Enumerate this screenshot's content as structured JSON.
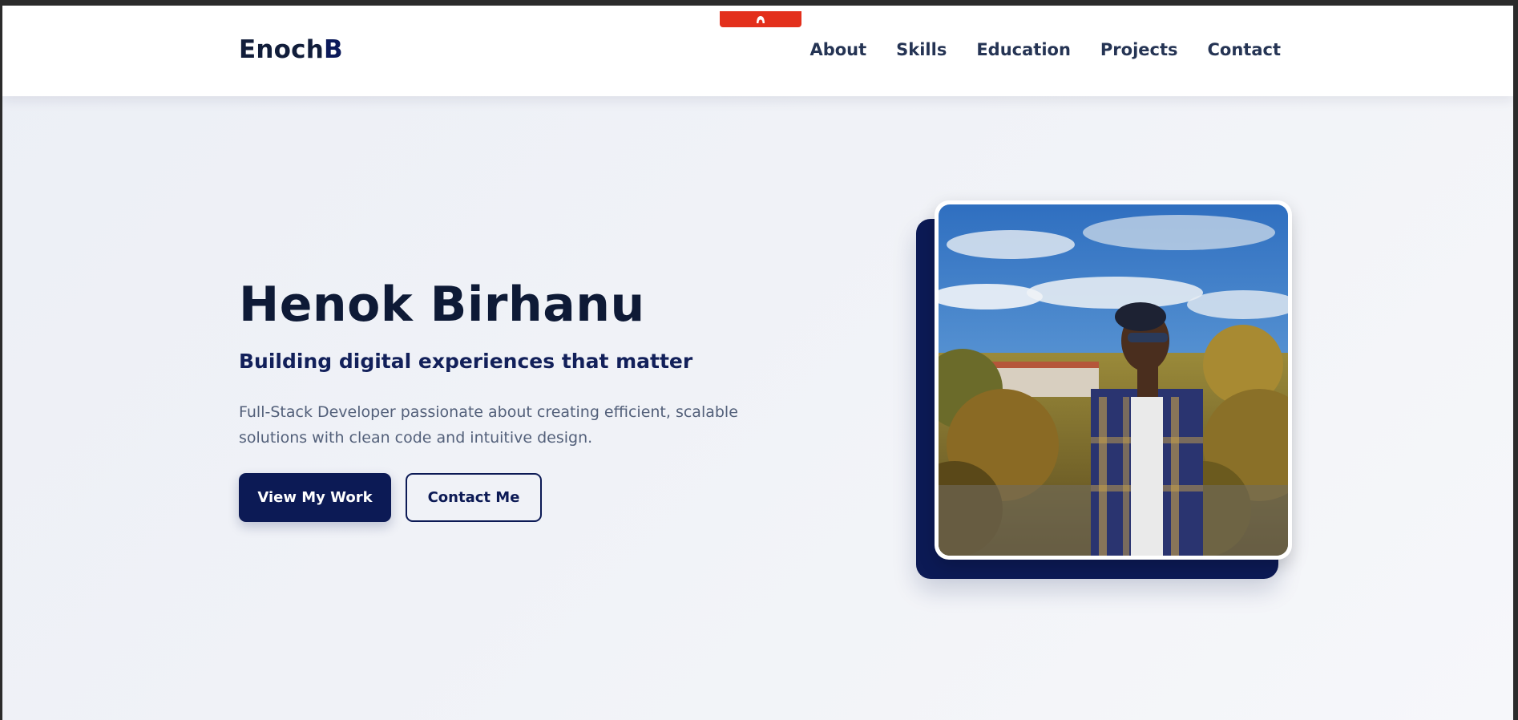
{
  "logo": {
    "text_main": "Enoch",
    "text_accent": "B"
  },
  "nav": {
    "items": [
      {
        "label": "About"
      },
      {
        "label": "Skills"
      },
      {
        "label": "Education"
      },
      {
        "label": "Projects"
      },
      {
        "label": "Contact"
      }
    ]
  },
  "hero": {
    "title": "Henok Birhanu",
    "subtitle": "Building digital experiences that matter",
    "description_line1": "Full-Stack Developer passionate about creating efficient, scalable",
    "description_line2": "solutions with clean code and intuitive design.",
    "primary_button": "View My Work",
    "secondary_button": "Contact Me"
  },
  "colors": {
    "brand_navy": "#0c1a55",
    "heading": "#0e1a36",
    "nav_text": "#253454",
    "body_text": "#53607a",
    "extension_red": "#e3301c"
  },
  "icons": {
    "extension_tab": "brave-shield-icon"
  }
}
